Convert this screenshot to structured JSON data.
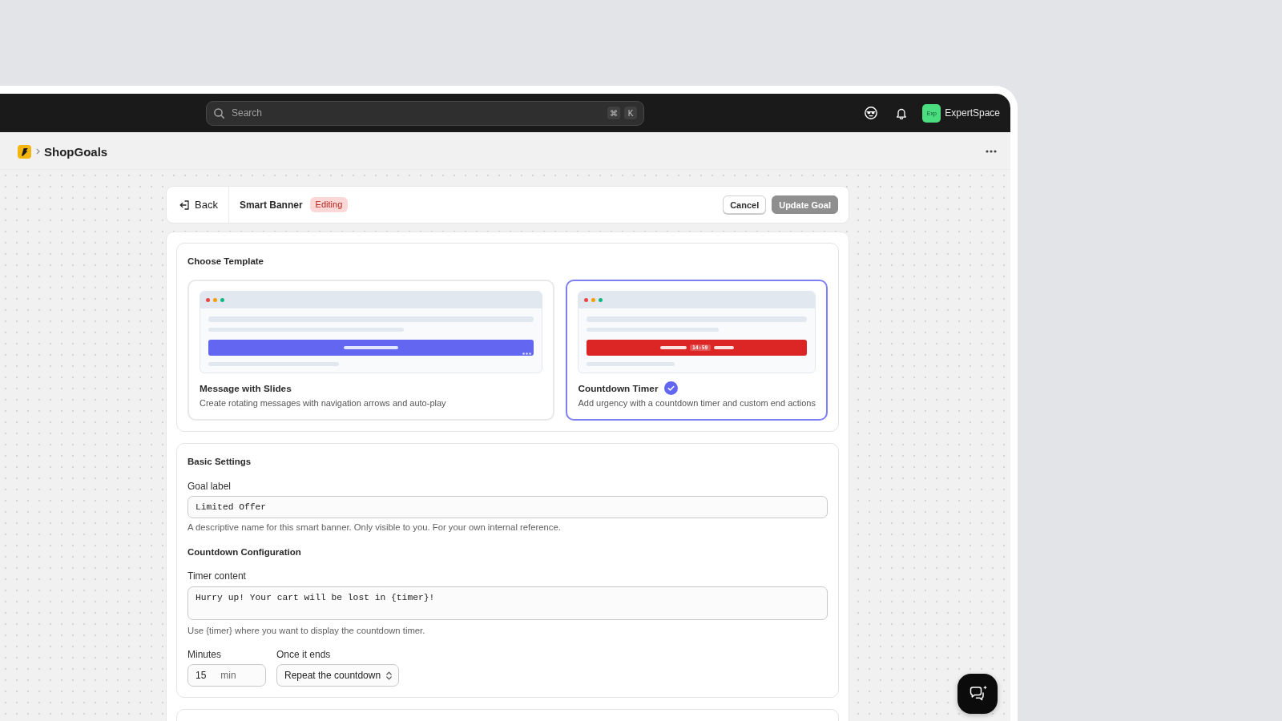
{
  "top_bar": {
    "search": {
      "placeholder": "Search",
      "shortcut_keys": [
        "⌘",
        "K"
      ]
    },
    "account": {
      "avatar_text": "Exp",
      "name": "ExpertSpace"
    }
  },
  "breadcrumb": {
    "app_name": "ShopGoals"
  },
  "header": {
    "back_label": "Back",
    "title": "Smart Banner",
    "status_badge": "Editing",
    "buttons": [
      {
        "label": "Cancel",
        "kind": "secondary",
        "disabled": false
      },
      {
        "label": "Update Goal",
        "kind": "primary",
        "disabled": true
      }
    ]
  },
  "template_section": {
    "title": "Choose Template",
    "templates": [
      {
        "kind": "slides",
        "title": "Message with Slides",
        "description": "Create rotating messages with navigation arrows and auto-play",
        "selected": false
      },
      {
        "kind": "countdown",
        "title": "Countdown Timer",
        "description": "Add urgency with a countdown timer and custom end actions",
        "selected": true,
        "timer_text": "14:59"
      }
    ]
  },
  "basic_settings": {
    "title": "Basic Settings",
    "goal_label": {
      "label": "Goal label",
      "value": "Limited Offer",
      "help": "A descriptive name for this smart banner. Only visible to you. For your own internal reference."
    },
    "countdown_configuration": {
      "title": "Countdown Configuration",
      "timer_content": {
        "label": "Timer content",
        "value": "Hurry up! Your cart will be lost in {timer}!",
        "help": "Use {timer} where you want to display the countdown timer."
      },
      "minutes": {
        "label": "Minutes",
        "value": "15",
        "unit": "min"
      },
      "end_action": {
        "label": "Once it ends",
        "value": "Repeat the countdown"
      }
    }
  }
}
